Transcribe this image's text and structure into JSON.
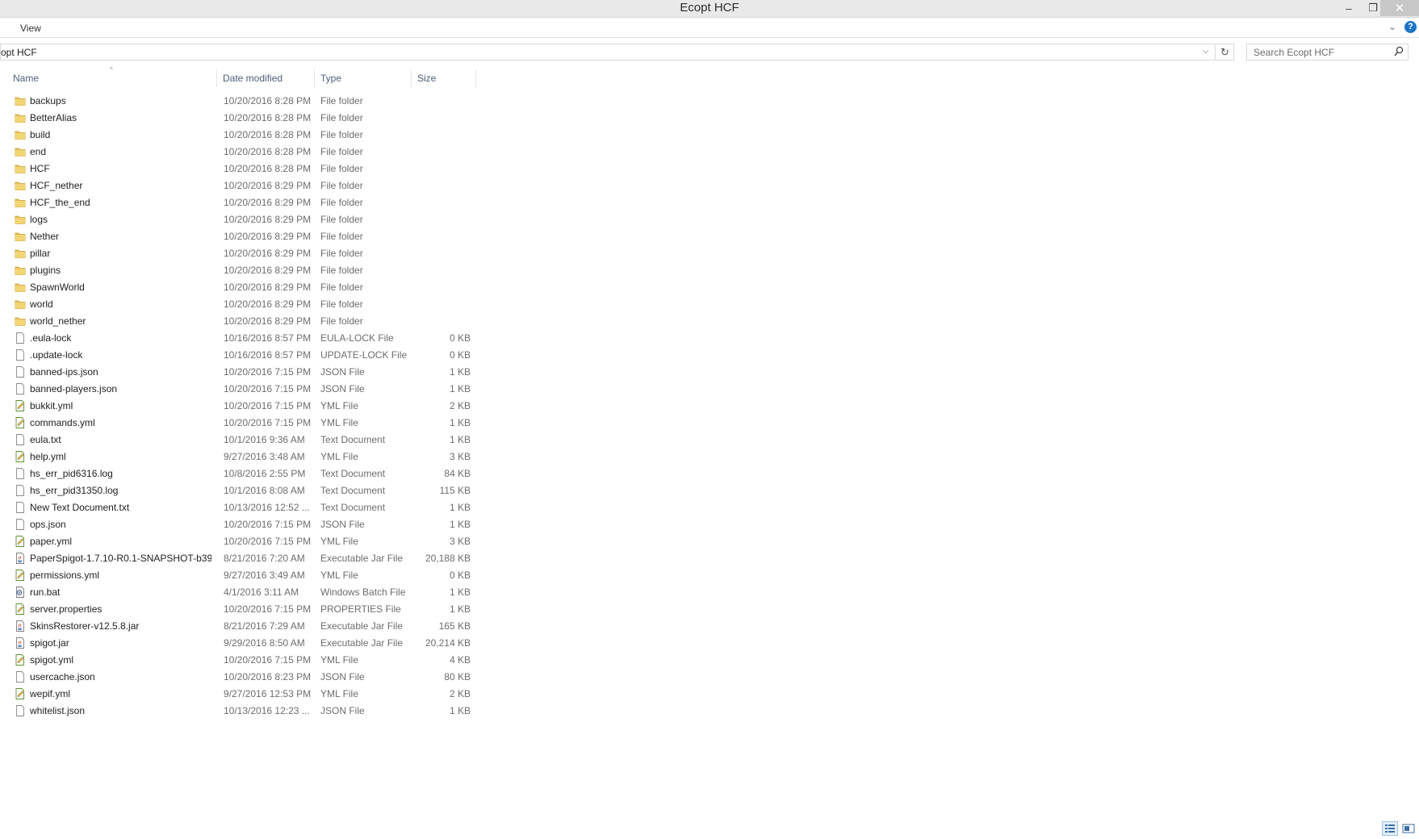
{
  "window": {
    "title": "Ecopt HCF",
    "minimize_glyph": "–",
    "maximize_glyph": "❐",
    "close_glyph": "✕"
  },
  "ribbon": {
    "view_label": "View",
    "expand_glyph": "⌄",
    "help_glyph": "?"
  },
  "address": {
    "path_text": "opt HCF",
    "dropdown_glyph": "⌵",
    "refresh_glyph": "↻"
  },
  "search": {
    "placeholder": "Search Ecopt HCF",
    "icon": "search-icon"
  },
  "columns": {
    "name": "Name",
    "date": "Date modified",
    "type": "Type",
    "size": "Size",
    "sort_glyph": "^"
  },
  "files": [
    {
      "name": "backups",
      "date": "10/20/2016 8:28 PM",
      "type": "File folder",
      "size": "",
      "icon": "folder"
    },
    {
      "name": "BetterAlias",
      "date": "10/20/2016 8:28 PM",
      "type": "File folder",
      "size": "",
      "icon": "folder"
    },
    {
      "name": "build",
      "date": "10/20/2016 8:28 PM",
      "type": "File folder",
      "size": "",
      "icon": "folder"
    },
    {
      "name": "end",
      "date": "10/20/2016 8:28 PM",
      "type": "File folder",
      "size": "",
      "icon": "folder"
    },
    {
      "name": "HCF",
      "date": "10/20/2016 8:28 PM",
      "type": "File folder",
      "size": "",
      "icon": "folder"
    },
    {
      "name": "HCF_nether",
      "date": "10/20/2016 8:29 PM",
      "type": "File folder",
      "size": "",
      "icon": "folder"
    },
    {
      "name": "HCF_the_end",
      "date": "10/20/2016 8:29 PM",
      "type": "File folder",
      "size": "",
      "icon": "folder"
    },
    {
      "name": "logs",
      "date": "10/20/2016 8:29 PM",
      "type": "File folder",
      "size": "",
      "icon": "folder"
    },
    {
      "name": "Nether",
      "date": "10/20/2016 8:29 PM",
      "type": "File folder",
      "size": "",
      "icon": "folder"
    },
    {
      "name": "pillar",
      "date": "10/20/2016 8:29 PM",
      "type": "File folder",
      "size": "",
      "icon": "folder"
    },
    {
      "name": "plugins",
      "date": "10/20/2016 8:29 PM",
      "type": "File folder",
      "size": "",
      "icon": "folder"
    },
    {
      "name": "SpawnWorld",
      "date": "10/20/2016 8:29 PM",
      "type": "File folder",
      "size": "",
      "icon": "folder"
    },
    {
      "name": "world",
      "date": "10/20/2016 8:29 PM",
      "type": "File folder",
      "size": "",
      "icon": "folder"
    },
    {
      "name": "world_nether",
      "date": "10/20/2016 8:29 PM",
      "type": "File folder",
      "size": "",
      "icon": "folder"
    },
    {
      "name": ".eula-lock",
      "date": "10/16/2016 8:57 PM",
      "type": "EULA-LOCK File",
      "size": "0 KB",
      "icon": "file"
    },
    {
      "name": ".update-lock",
      "date": "10/16/2016 8:57 PM",
      "type": "UPDATE-LOCK File",
      "size": "0 KB",
      "icon": "file"
    },
    {
      "name": "banned-ips.json",
      "date": "10/20/2016 7:15 PM",
      "type": "JSON File",
      "size": "1 KB",
      "icon": "file"
    },
    {
      "name": "banned-players.json",
      "date": "10/20/2016 7:15 PM",
      "type": "JSON File",
      "size": "1 KB",
      "icon": "file"
    },
    {
      "name": "bukkit.yml",
      "date": "10/20/2016 7:15 PM",
      "type": "YML File",
      "size": "2 KB",
      "icon": "edit"
    },
    {
      "name": "commands.yml",
      "date": "10/20/2016 7:15 PM",
      "type": "YML File",
      "size": "1 KB",
      "icon": "edit"
    },
    {
      "name": "eula.txt",
      "date": "10/1/2016 9:36 AM",
      "type": "Text Document",
      "size": "1 KB",
      "icon": "file"
    },
    {
      "name": "help.yml",
      "date": "9/27/2016 3:48 AM",
      "type": "YML File",
      "size": "3 KB",
      "icon": "edit"
    },
    {
      "name": "hs_err_pid6316.log",
      "date": "10/8/2016 2:55 PM",
      "type": "Text Document",
      "size": "84 KB",
      "icon": "file"
    },
    {
      "name": "hs_err_pid31350.log",
      "date": "10/1/2016 8:08 AM",
      "type": "Text Document",
      "size": "115 KB",
      "icon": "file"
    },
    {
      "name": "New Text Document.txt",
      "date": "10/13/2016 12:52 ...",
      "type": "Text Document",
      "size": "1 KB",
      "icon": "file"
    },
    {
      "name": "ops.json",
      "date": "10/20/2016 7:15 PM",
      "type": "JSON File",
      "size": "1 KB",
      "icon": "file"
    },
    {
      "name": "paper.yml",
      "date": "10/20/2016 7:15 PM",
      "type": "YML File",
      "size": "3 KB",
      "icon": "edit"
    },
    {
      "name": "PaperSpigot-1.7.10-R0.1-SNAPSHOT-b39...",
      "date": "8/21/2016 7:20 AM",
      "type": "Executable Jar File",
      "size": "20,188 KB",
      "icon": "jar"
    },
    {
      "name": "permissions.yml",
      "date": "9/27/2016 3:49 AM",
      "type": "YML File",
      "size": "0 KB",
      "icon": "edit"
    },
    {
      "name": "run.bat",
      "date": "4/1/2016 3:11 AM",
      "type": "Windows Batch File",
      "size": "1 KB",
      "icon": "bat"
    },
    {
      "name": "server.properties",
      "date": "10/20/2016 7:15 PM",
      "type": "PROPERTIES File",
      "size": "1 KB",
      "icon": "edit"
    },
    {
      "name": "SkinsRestorer-v12.5.8.jar",
      "date": "8/21/2016 7:29 AM",
      "type": "Executable Jar File",
      "size": "165 KB",
      "icon": "jar"
    },
    {
      "name": "spigot.jar",
      "date": "9/29/2016 8:50 AM",
      "type": "Executable Jar File",
      "size": "20,214 KB",
      "icon": "jar"
    },
    {
      "name": "spigot.yml",
      "date": "10/20/2016 7:15 PM",
      "type": "YML File",
      "size": "4 KB",
      "icon": "edit"
    },
    {
      "name": "usercache.json",
      "date": "10/20/2016 8:23 PM",
      "type": "JSON File",
      "size": "80 KB",
      "icon": "file"
    },
    {
      "name": "wepif.yml",
      "date": "9/27/2016 12:53 PM",
      "type": "YML File",
      "size": "2 KB",
      "icon": "edit"
    },
    {
      "name": "whitelist.json",
      "date": "10/13/2016 12:23 ...",
      "type": "JSON File",
      "size": "1 KB",
      "icon": "file"
    }
  ]
}
